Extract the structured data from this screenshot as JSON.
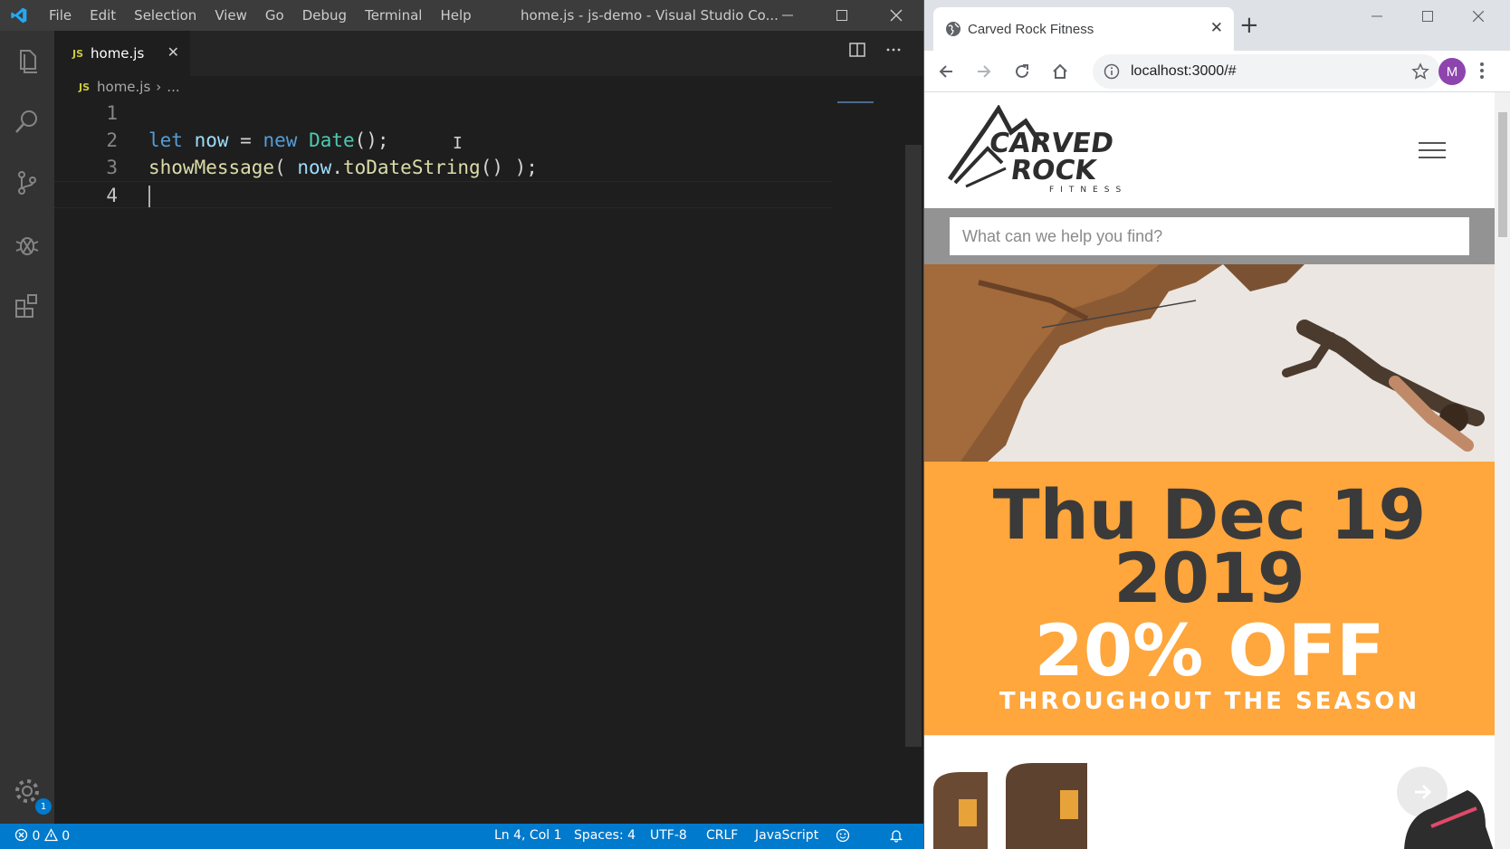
{
  "vscode": {
    "menu": [
      "File",
      "Edit",
      "Selection",
      "View",
      "Go",
      "Debug",
      "Terminal",
      "Help"
    ],
    "window_title": "home.js - js-demo - Visual Studio Co...",
    "settings_badge": "1",
    "tab": {
      "icon_label": "JS",
      "name": "home.js"
    },
    "breadcrumb": {
      "icon_label": "JS",
      "file": "home.js",
      "more": "..."
    },
    "editor": {
      "lines": [
        {
          "num": "1",
          "tokens": []
        },
        {
          "num": "2",
          "tokens": [
            {
              "t": "let",
              "c": "kw"
            },
            {
              "t": " ",
              "c": "pun"
            },
            {
              "t": "now",
              "c": "var"
            },
            {
              "t": " = ",
              "c": "pun"
            },
            {
              "t": "new",
              "c": "kw"
            },
            {
              "t": " ",
              "c": "pun"
            },
            {
              "t": "Date",
              "c": "cls"
            },
            {
              "t": "();",
              "c": "pun"
            }
          ]
        },
        {
          "num": "3",
          "tokens": [
            {
              "t": "showMessage",
              "c": "fn"
            },
            {
              "t": "( ",
              "c": "pun"
            },
            {
              "t": "now",
              "c": "var"
            },
            {
              "t": ".",
              "c": "pun"
            },
            {
              "t": "toDateString",
              "c": "fn"
            },
            {
              "t": "() );",
              "c": "pun"
            }
          ]
        },
        {
          "num": "4",
          "tokens": []
        }
      ],
      "active_line": 4
    },
    "status": {
      "errors": "0",
      "warnings": "0",
      "position": "Ln 4, Col 1",
      "spaces": "Spaces: 4",
      "encoding": "UTF-8",
      "eol": "CRLF",
      "language": "JavaScript"
    },
    "colors": {
      "status_bar": "#007acc",
      "activity_bar": "#333333",
      "editor_bg": "#1e1e1e"
    }
  },
  "chrome": {
    "tab_title": "Carved Rock Fitness",
    "url": "localhost:3000/#",
    "avatar_letter": "M",
    "page": {
      "search_placeholder": "What can we help you find?",
      "promo_date_line1": "Thu Dec 19",
      "promo_date_line2": "2019",
      "promo_offer": "20% OFF",
      "promo_tagline": "THROUGHOUT THE SEASON",
      "brand_colors": {
        "promo_bg": "#ffa63c",
        "search_band": "#939393"
      }
    }
  }
}
